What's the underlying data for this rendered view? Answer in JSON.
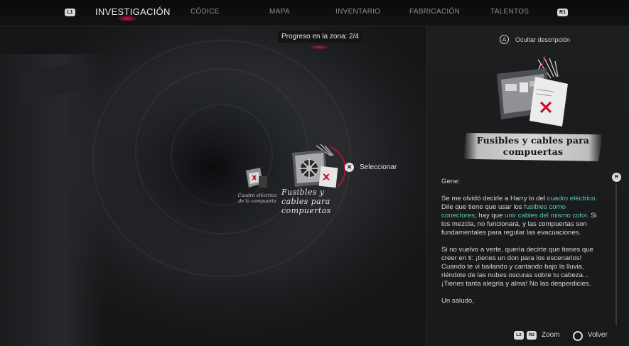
{
  "nav": {
    "left_button": "L1",
    "right_button": "R1",
    "tabs": [
      "INVESTIGACIÓN",
      "CÓDICE",
      "MAPA",
      "INVENTARIO",
      "FABRICACIÓN",
      "TALENTOS"
    ],
    "active_tab": "INVESTIGACIÓN"
  },
  "progress": {
    "text": "Progreso en la zona:  2/4"
  },
  "board": {
    "small_node_label": "Cuadro eléctrico de la compuerta",
    "selected_node_label": "Fusibles y cables para compuertas",
    "select_button": "✕",
    "select_label": "Seleccionar"
  },
  "panel": {
    "hide_button": "△",
    "hide_label": "Ocultar descripción",
    "title": "Fusibles y cables para compuertas",
    "greeting": "Gene:",
    "p1_a": "Se me olvidó decirle a Harry lo del ",
    "p1_h1": "cuadro eléctrico",
    "p1_b": ". Dile que tiene que usar los ",
    "p1_h2": "fusibles como conectores",
    "p1_c": "; hay que ",
    "p1_h3": "unir cables del mismo color",
    "p1_d": ". Si los mezcla, no funcionará, y las compuertas son fundamentales para regular las evacuaciones.",
    "p2": "Si no vuelvo a verte, quería decirte que tienes que creer en ti: ¡tienes un don para los escenarios! Cuando te vi bailando y cantando bajo la lluvia, riéndote de las nubes oscuras sobre tu cabeza... ¡Tienes tanta alegría y alma! No las desperdicies.",
    "closing": "Un saludo,",
    "scroll_button": "R"
  },
  "controls": {
    "zoom_left": "L2",
    "zoom_right": "R2",
    "zoom_label": "Zoom",
    "back_label": "Volver"
  },
  "colors": {
    "accent": "#d1123c",
    "highlight": "#5fc7a9"
  }
}
